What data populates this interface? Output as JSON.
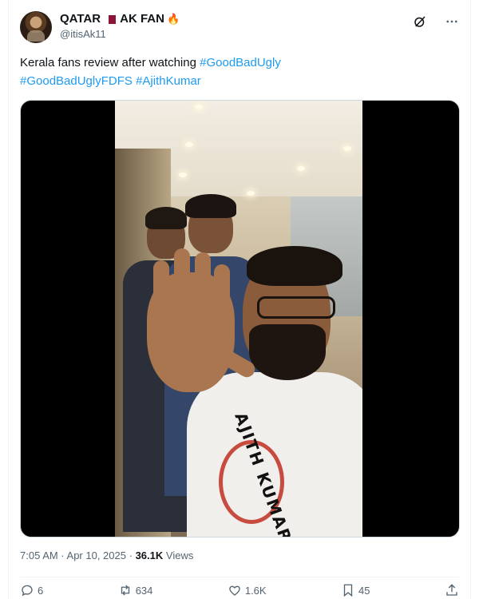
{
  "tweet": {
    "author_name": "QATAR",
    "author_name_suffix": "AK FAN",
    "author_handle": "@itisAk11",
    "text_prefix": "Kerala fans review after watching ",
    "hashtags": [
      "#GoodBadUgly",
      "#GoodBadUglyFDFS",
      "#AjithKumar"
    ],
    "timestamp": "7:05 AM · Apr 10, 2025",
    "views_count": "36.1K",
    "views_label": "Views",
    "media_print_text": "AJITH KUMAR"
  },
  "actions": {
    "reply": "6",
    "retweet": "634",
    "like": "1.6K",
    "bookmark": "45"
  },
  "icons": {
    "flag": "qatar-flag-icon",
    "emoji": "fire-emoji-icon",
    "grok": "grok-icon",
    "more": "more-icon",
    "reply": "reply-icon",
    "retweet": "retweet-icon",
    "like": "like-icon",
    "bookmark": "bookmark-icon",
    "share": "share-icon"
  },
  "colors": {
    "accent": "#1d9bf0",
    "text": "#0f1419",
    "muted": "#536471"
  }
}
